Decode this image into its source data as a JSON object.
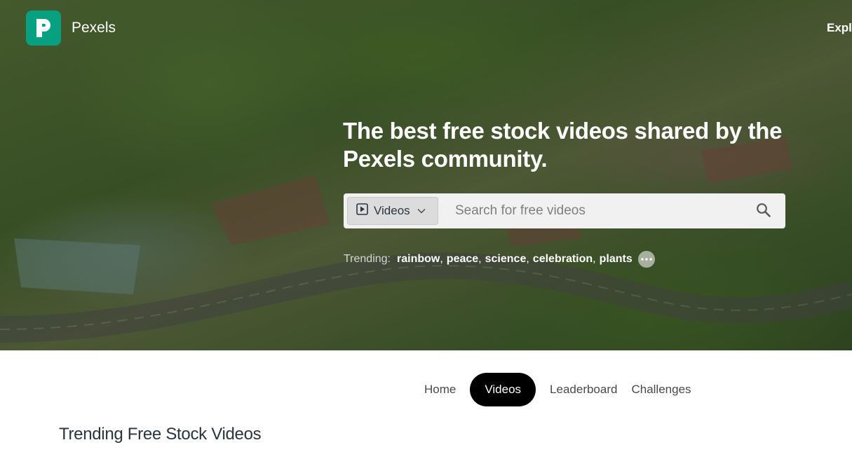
{
  "brand": {
    "name": "Pexels"
  },
  "header": {
    "nav_explore": "Explo"
  },
  "hero": {
    "headline": "The best free stock videos shared by the Pexels community.",
    "search": {
      "type_selected": "Videos",
      "placeholder": "Search for free videos"
    },
    "trending": {
      "label": "Trending:",
      "items": [
        "rainbow",
        "peace",
        "science",
        "celebration",
        "plants"
      ]
    }
  },
  "tabs": [
    {
      "label": "Home",
      "active": false
    },
    {
      "label": "Videos",
      "active": true
    },
    {
      "label": "Leaderboard",
      "active": false
    },
    {
      "label": "Challenges",
      "active": false
    }
  ],
  "section": {
    "title": "Trending Free Stock Videos"
  },
  "icons": {
    "logo": "pexels-logo-icon",
    "video_type": "play-square-icon",
    "dropdown": "chevron-down-icon",
    "search": "search-icon",
    "more": "more-dots-icon"
  },
  "colors": {
    "brand": "#07a081",
    "active_tab": "#000000"
  }
}
